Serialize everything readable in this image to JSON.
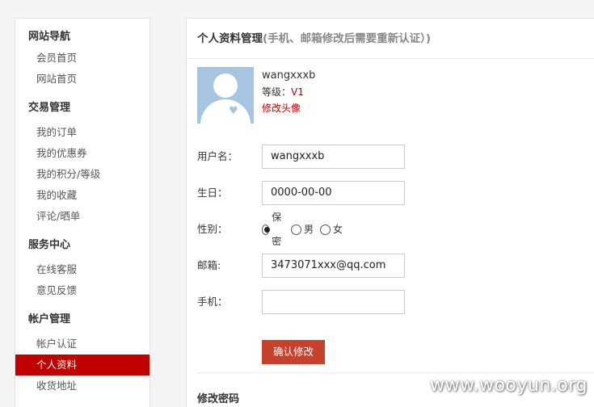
{
  "sidebar": {
    "groups": [
      {
        "title": "网站导航",
        "items": [
          "会员首页",
          "网站首页"
        ]
      },
      {
        "title": "交易管理",
        "items": [
          "我的订单",
          "我的优惠券",
          "我的积分/等级",
          "我的收藏",
          "评论/晒单"
        ]
      },
      {
        "title": "服务中心",
        "items": [
          "在线客服",
          "意见反馈"
        ]
      },
      {
        "title": "帐户管理",
        "items": [
          "帐户认证",
          "个人资料",
          "收货地址"
        ]
      }
    ],
    "active_item": "个人资料"
  },
  "main": {
    "title": "个人资料管理",
    "note": "(手机、邮箱修改后需要重新认证）)",
    "profile": {
      "username": "wangxxxb",
      "level_label": "等级：",
      "level_value": "V1",
      "edit_avatar": "修改头像"
    },
    "form": {
      "username_label": "用户名：",
      "username_value": "wangxxxb",
      "birthday_label": "生日：",
      "birthday_value": "0000-00-00",
      "gender_label": "性别：",
      "gender_options": [
        "保密",
        "男",
        "女"
      ],
      "gender_selected": "保密",
      "email_label": "邮箱:",
      "email_value": "3473071xxx@qq.com",
      "phone_label": "手机：",
      "phone_value": ""
    },
    "confirm_button": "确认修改",
    "password_section_title": "修改密码"
  },
  "watermark": "www.wooyun.org",
  "colors": {
    "accent": "#c10000",
    "button": "#c8412d"
  }
}
